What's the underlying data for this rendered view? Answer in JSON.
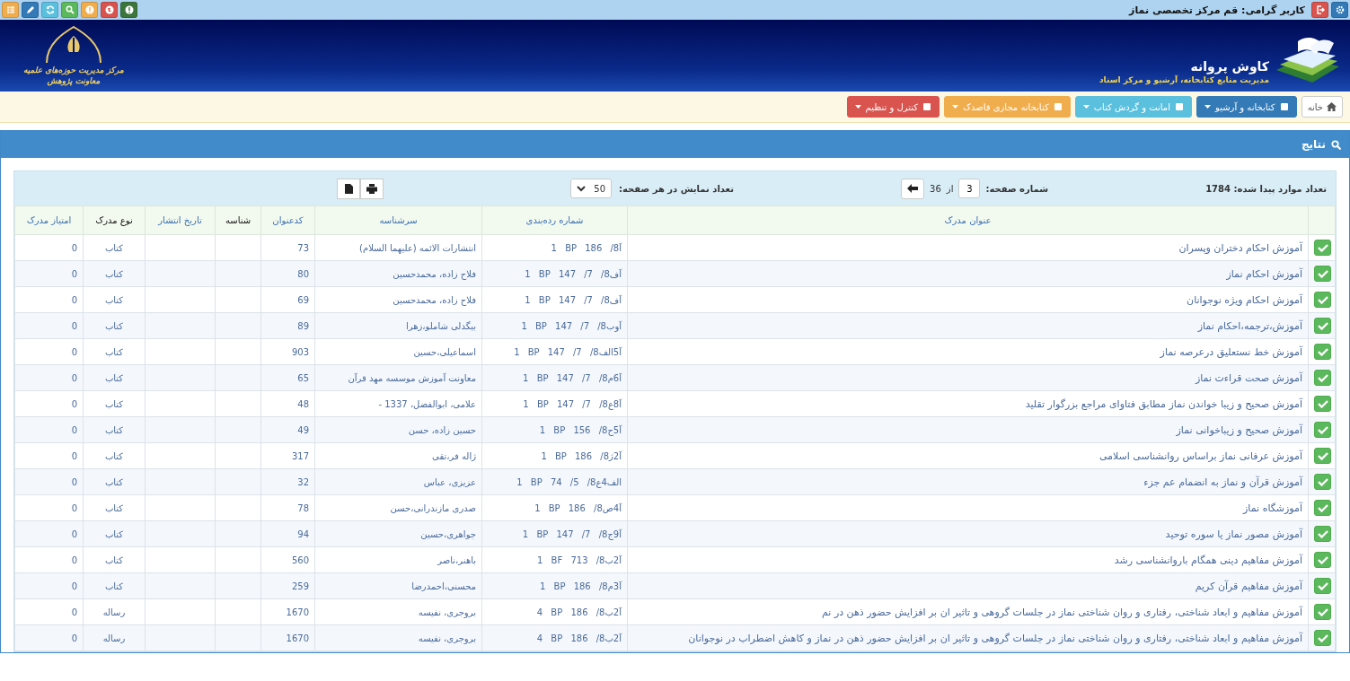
{
  "topbar": {
    "user": "کاربر گرامی: قم مرکز تخصصی نماز"
  },
  "header": {
    "app_name": "کاوش پروانه",
    "app_subtitle": "مدیریت منابع کتابخانه، آرشیو و مرکز اسناد",
    "org_line_1": "مرکز مدیریت حوزه‌های علمیه",
    "org_line_2": "معاونت پژوهش"
  },
  "nav": [
    {
      "label": "خانه",
      "kind": "home"
    },
    {
      "label": "کتابخانه و آرشیو",
      "kind": "menu",
      "color": "#337ab7"
    },
    {
      "label": "امانت و گردش کتاب",
      "kind": "menu",
      "color": "#5bc0de"
    },
    {
      "label": "کتابخانه مجازی قاصدک",
      "kind": "menu",
      "color": "#f0ad4e"
    },
    {
      "label": "کنترل و تنظیم",
      "kind": "menu",
      "color": "#d9534f"
    }
  ],
  "panel": {
    "title": "نتایج"
  },
  "toolbar": {
    "found_label": "تعداد موارد پیدا شده: 1784",
    "page_label": "شماره صفحه:",
    "page": "3",
    "of_label": "از",
    "page_count": "36",
    "per_page_label": "تعداد نمایش در هر صفحه:",
    "per_page": "50"
  },
  "table": {
    "columns": [
      {
        "label": "عنوان مدرک",
        "sortable": true
      },
      {
        "label": "شماره رده‌بندی",
        "sortable": true
      },
      {
        "label": "سرشناسه",
        "sortable": true
      },
      {
        "label": "کدعنوان",
        "sortable": true
      },
      {
        "label": "شناسه",
        "sortable": false
      },
      {
        "label": "تاریخ انتشار",
        "sortable": true
      },
      {
        "label": "نوع مدرک",
        "sortable": false
      },
      {
        "label": "امتیاز مدرک",
        "sortable": true
      }
    ],
    "rows": [
      {
        "checked": true,
        "title": "آموزش احکام دختران وپسران",
        "class": "1 BP 186 /8آ",
        "author": "انتشارات الائمه (علیهما السلام)",
        "code": "73",
        "type": "کتاب",
        "score": "0"
      },
      {
        "checked": true,
        "title": "آموزش احکام نماز",
        "class": "1 BP 147 /7 /8آف",
        "author": "فلاح زاده، محمدحسین",
        "code": "80",
        "type": "کتاب",
        "score": "0"
      },
      {
        "checked": true,
        "title": "آموزش احکام ویژه نوجوانان",
        "class": "1 BP 147 /7 /8آف",
        "author": "فلاح زاده، محمدحسین",
        "code": "69",
        "type": "کتاب",
        "score": "0"
      },
      {
        "checked": true,
        "title": "آموزش،ترجمه،احکام نماز",
        "class": "1 BP 147 /7 /8آوب",
        "author": "بیگدلی شاملو،زهرا",
        "code": "89",
        "type": "کتاب",
        "score": "0"
      },
      {
        "checked": true,
        "title": "آموزش خط نستعلیق درعرصه نماز",
        "class": "1 BP 147 /7 /8آ5الف",
        "author": "اسماعیلی،حسین",
        "code": "903",
        "type": "کتاب",
        "score": "0"
      },
      {
        "checked": true,
        "title": "آموزش صحت قراءت نماز",
        "class": "1 BP 147 /7 /8آ6م",
        "author": "معاونت آموزش موسسه مهد قرآن",
        "code": "65",
        "type": "کتاب",
        "score": "0"
      },
      {
        "checked": true,
        "title": "آموزش صحیح و زیبا خواندن نماز مطابق فتاوای مراجع بزرگوار تقلید",
        "class": "1 BP 147 /7 /8آ8ع",
        "author": "علامی، ابوالفضل، 1337 -",
        "code": "48",
        "type": "کتاب",
        "score": "0"
      },
      {
        "checked": true,
        "title": "آموزش صحیح و زیباخوانی نماز",
        "class": "1 BP 156 /8آ5ح",
        "author": "حسین زاده، حسن",
        "code": "49",
        "type": "کتاب",
        "score": "0"
      },
      {
        "checked": true,
        "title": "آموزش عرفانی نماز براساس روانشناسی اسلامی",
        "class": "1 BP 186 /8آ2ژ",
        "author": "ژاله فر،تقی",
        "code": "317",
        "type": "کتاب",
        "score": "0"
      },
      {
        "checked": true,
        "title": "آموزش قرآن و نماز به انضمام عم جزء",
        "class": "1 BP 74 /5 /8الف4ع",
        "author": "عزیزی، عباس",
        "code": "32",
        "type": "کتاب",
        "score": "0"
      },
      {
        "checked": true,
        "title": "آموزشگاه نماز",
        "class": "1 BP 186 /8آ4ص",
        "author": "صدری مازندرانی،حسن",
        "code": "78",
        "type": "کتاب",
        "score": "0"
      },
      {
        "checked": true,
        "title": "آموزش مصور نماز یا سوره توحید",
        "class": "1 BP 147 /7 /8آ9ج",
        "author": "جواهری،حسین",
        "code": "94",
        "type": "کتاب",
        "score": "0"
      },
      {
        "checked": true,
        "title": "آموزش مفاهیم دینی همگام باروانشناسی رشد",
        "class": "1 BF 713 /8آ2ب",
        "author": "باهنر،ناصر",
        "code": "560",
        "type": "کتاب",
        "score": "0"
      },
      {
        "checked": true,
        "title": "آموزش مفاهیم قرآن کریم",
        "class": "1 BP 186 /8آ3م",
        "author": "محسنی،احمدرضا",
        "code": "259",
        "type": "کتاب",
        "score": "0"
      },
      {
        "checked": true,
        "title": "آموزش مفاهیم و ابعاد شناختی، رفتاری و روان شناختی نماز در جلسات گروهی و تاثیر ان بر افزایش حضور ذهن در نم",
        "class": "4 BP 186 /8آ2ب",
        "author": "بروجری، نفیسه",
        "code": "1670",
        "type": "رساله",
        "score": "0"
      },
      {
        "checked": true,
        "title": "آموزش مفاهیم و ابعاد شناختی، رفتاری و روان شناختی نماز در جلسات گروهی و تاثیر ان بر افزایش حضور ذهن در نماز و کاهش اضطراب در نوجوانان",
        "class": "4 BP 186 /8آ2ب",
        "author": "بروجری، نفیسه",
        "code": "1670",
        "type": "رساله",
        "score": "0"
      }
    ]
  }
}
